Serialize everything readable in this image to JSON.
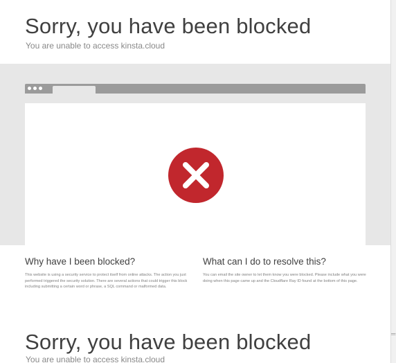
{
  "header": {
    "title": "Sorry, you have been blocked",
    "subtitle": "You are unable to access kinsta.cloud"
  },
  "error": {
    "icon": "error-x-icon",
    "color": "#c1272d"
  },
  "why": {
    "heading": "Why have I been blocked?",
    "body": "This website is using a security service to protect itself from online attacks. The action you just performed triggered the security solution. There are several actions that could trigger this block including submitting a certain word or phrase, a SQL command or malformed data."
  },
  "resolve": {
    "heading": "What can I do to resolve this?",
    "body": "You can email the site owner to let them know you were blocked. Please include what you were doing when this page came up and the Cloudflare Ray ID found at the bottom of this page."
  },
  "repeat": {
    "title": "Sorry, you have been blocked",
    "subtitle": "You are unable to access kinsta.cloud"
  }
}
